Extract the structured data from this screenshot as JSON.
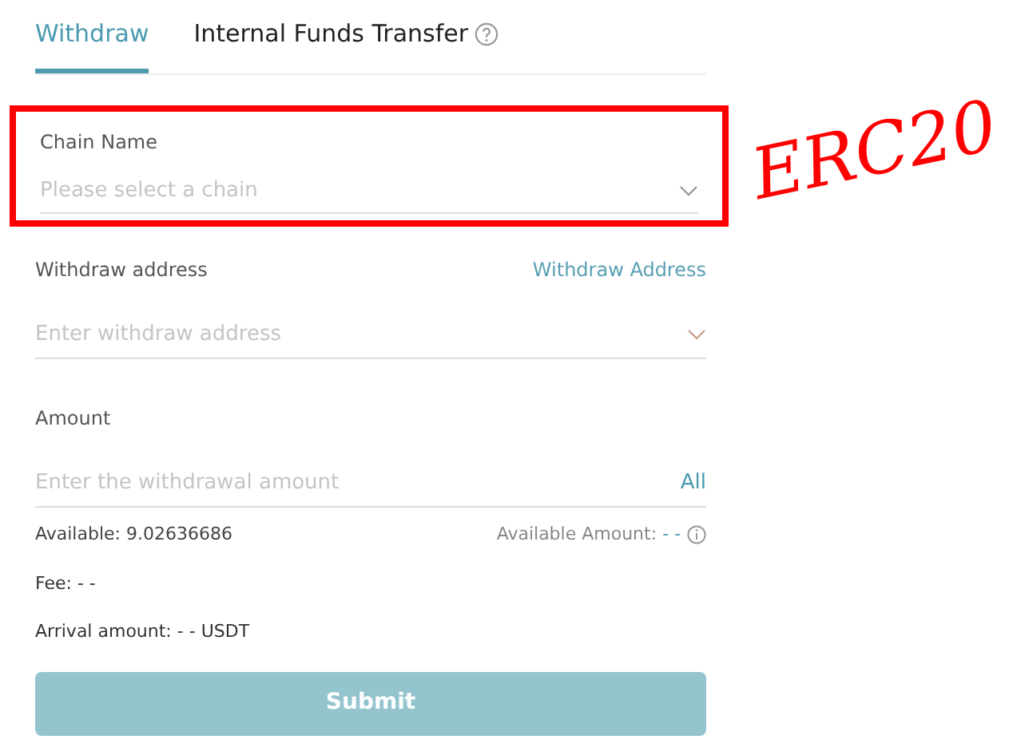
{
  "tabs": [
    {
      "label": "Withdraw",
      "selected": true
    },
    {
      "label": "Internal Funds Transfer",
      "selected": false,
      "help": true
    }
  ],
  "chain": {
    "label": "Chain Name",
    "placeholder": "Please select a chain",
    "highlighted": true
  },
  "annotation": "ERC20",
  "address": {
    "label": "Withdraw address",
    "link": "Withdraw Address",
    "placeholder": "Enter withdraw address"
  },
  "amount": {
    "label": "Amount",
    "placeholder": "Enter the withdrawal amount",
    "all": "All"
  },
  "available": "Available: 9.02636686",
  "available_amount": {
    "label": "Available Amount:",
    "value": "- -"
  },
  "fee": "Fee: - -",
  "arrival": "Arrival amount: - - USDT",
  "submit": {
    "label": "Submit",
    "disabled": true
  }
}
